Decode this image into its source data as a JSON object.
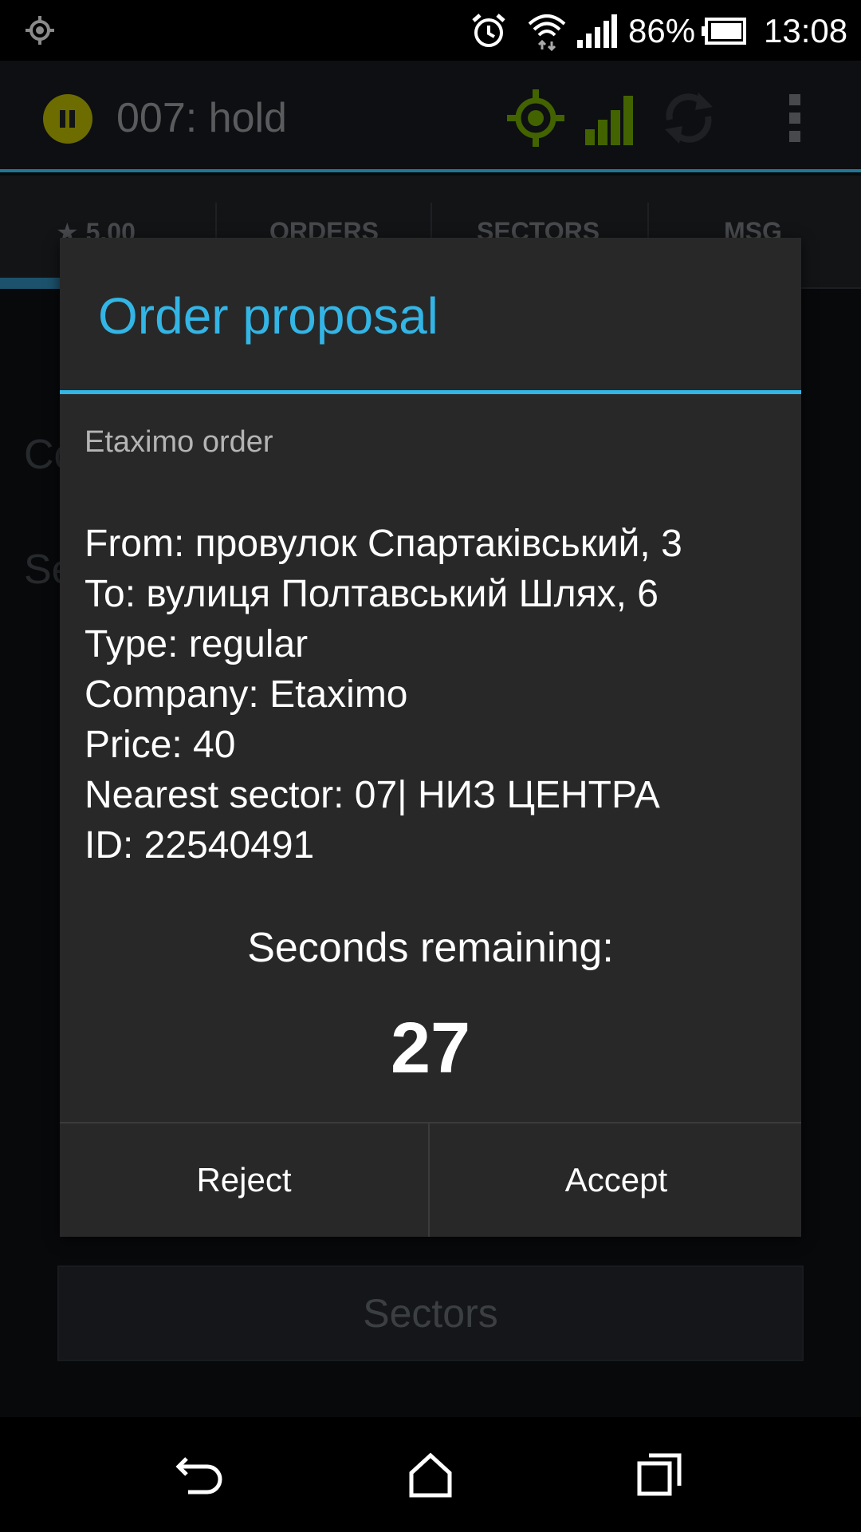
{
  "status_bar": {
    "battery_percent": "86%",
    "time": "13:08",
    "icons": [
      "location-icon",
      "alarm-icon",
      "wifi-icon",
      "signal-icon",
      "battery-icon"
    ]
  },
  "action_bar": {
    "title": "007: hold",
    "icons": [
      "pause-icon",
      "gps-icon",
      "signal-bars-icon",
      "refresh-icon",
      "overflow-menu-icon"
    ],
    "colors": {
      "gps": "#669900",
      "pause": "#a8a600",
      "accent": "#33b5e5"
    }
  },
  "tabs": {
    "rating": "5.00",
    "items": [
      "ORDERS",
      "SECTORS",
      "MSG"
    ]
  },
  "background": {
    "line1": "Co",
    "line2": "Se",
    "sectors_button": "Sectors"
  },
  "dialog": {
    "title": "Order proposal",
    "subtitle": "Etaximo order",
    "details": [
      "From: провулок Спартаківський, 3",
      "To: вулиця Полтавський Шлях, 6",
      "Type: regular",
      "Company: Etaximo",
      "Price: 40",
      "Nearest sector: 07| НИЗ ЦЕНТРА",
      "ID: 22540491"
    ],
    "countdown_label": "Seconds remaining:",
    "countdown_value": "27",
    "reject_label": "Reject",
    "accept_label": "Accept"
  }
}
